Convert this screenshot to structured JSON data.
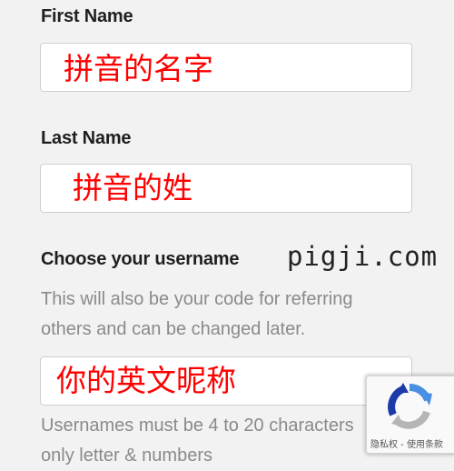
{
  "form": {
    "first_name": {
      "label": "First Name",
      "value": "",
      "annotation": "拼音的名字"
    },
    "last_name": {
      "label": "Last Name",
      "value": "",
      "annotation": "拼音的姓"
    },
    "username": {
      "label": "Choose your username",
      "help_line1": "This will also be your code for referring",
      "help_line2": "others and can be changed later.",
      "value": "",
      "annotation": "你的英文昵称",
      "hint_line1": "Usernames must be 4 to 20 characters",
      "hint_line2": "only letter & numbers"
    }
  },
  "watermark": "pigji.com",
  "recaptcha": {
    "icon": "recaptcha-icon",
    "text": "隐私权 - 使用条款"
  },
  "colors": {
    "background": "#f2f2f2",
    "annotation": "#ff0000",
    "label": "#1f1f1f",
    "help_text": "#8a8a8a",
    "recaptcha_blue": "#1c3aa9",
    "recaptcha_gray": "#b5b5b5"
  }
}
